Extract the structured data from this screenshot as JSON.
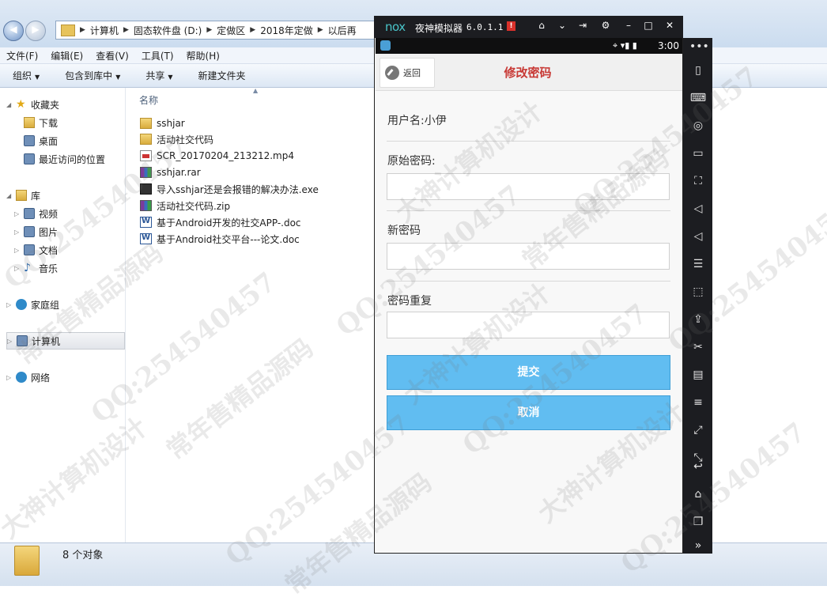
{
  "explorer": {
    "breadcrumbs": [
      "计算机",
      "固态软件盘 (D:)",
      "定做区",
      "2018年定做",
      "以后再"
    ],
    "menu": [
      "文件(F)",
      "编辑(E)",
      "查看(V)",
      "工具(T)",
      "帮助(H)"
    ],
    "toolbar": [
      "组织",
      "包含到库中",
      "共享",
      "新建文件夹"
    ],
    "sidebar": {
      "favorites": "收藏夹",
      "downloads": "下载",
      "desktop": "桌面",
      "recent": "最近访问的位置",
      "libraries": "库",
      "videos": "视频",
      "pictures": "图片",
      "documents": "文档",
      "music": "音乐",
      "homegroup": "家庭组",
      "computer": "计算机",
      "network": "网络"
    },
    "column_header": "名称",
    "files": [
      {
        "name": "sshjar",
        "icon": "folder-icon"
      },
      {
        "name": "活动社交代码",
        "icon": "folder-icon"
      },
      {
        "name": "SCR_20170204_213212.mp4",
        "icon": "video-file-icon"
      },
      {
        "name": "sshjar.rar",
        "icon": "rar-archive-icon"
      },
      {
        "name": "导入sshjar还是会报错的解决办法.exe",
        "icon": "exe-file-icon"
      },
      {
        "name": "活动社交代码.zip",
        "icon": "zip-archive-icon"
      },
      {
        "name": "基于Android开发的社交APP-.doc",
        "icon": "word-doc-icon"
      },
      {
        "name": "基于Android社交平台---论文.doc",
        "icon": "word-doc-icon"
      }
    ],
    "status": "8 个对象"
  },
  "emulator": {
    "logo": "nox",
    "name": "夜神模拟器",
    "version": "6.0.1.1",
    "badge": "!",
    "time": "3:00"
  },
  "app": {
    "back": "返回",
    "title": "修改密码",
    "username_label": "用户名:小伊",
    "old_password_label": "原始密码:",
    "new_password_label": "新密码",
    "repeat_password_label": "密码重复",
    "old_password_value": "",
    "new_password_value": "",
    "repeat_password_value": "",
    "submit": "提交",
    "cancel": "取消"
  },
  "watermarks": [
    "QQ:254540457",
    "常年售精品源码",
    "大神计算机设计"
  ],
  "colors": {
    "title_red": "#c83a36",
    "button_blue": "#61bdf1",
    "nox_dark": "#1c1d21"
  }
}
